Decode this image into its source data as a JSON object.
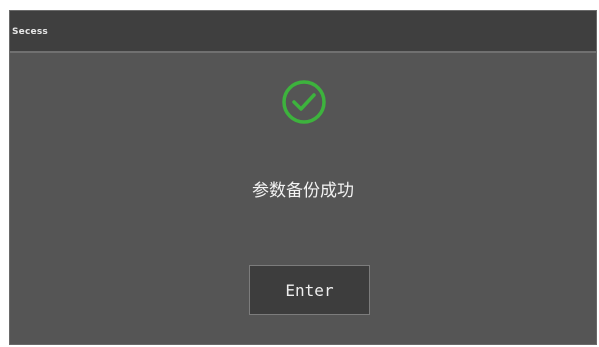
{
  "dialog": {
    "title": "Secess",
    "icon": "check-circle-icon",
    "message": "参数备份成功",
    "enter_label": "Enter"
  },
  "colors": {
    "background": "#555555",
    "title_bar": "#3f3f3f",
    "check_green": "#3db33d",
    "button_bg": "#3d3d3d",
    "text": "#f2f2f2"
  }
}
